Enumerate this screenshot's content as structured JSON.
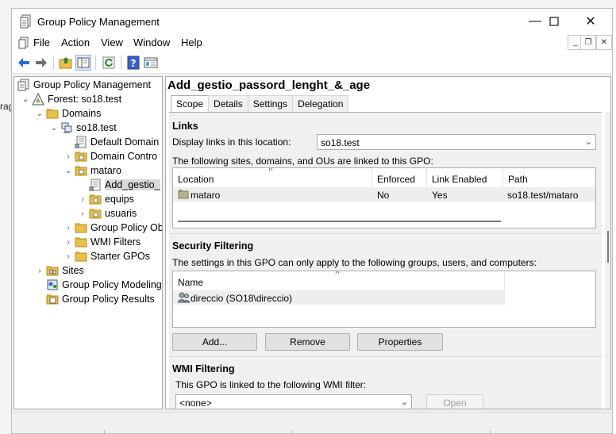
{
  "background": {
    "left_text": "rag"
  },
  "window": {
    "title": "Group Policy Management",
    "controls": {
      "minimize": "—",
      "maximize": "☐",
      "close": "✕"
    }
  },
  "menu": {
    "items": [
      "File",
      "Action",
      "View",
      "Window",
      "Help"
    ],
    "mdi": {
      "minimize": "_",
      "restore": "❐",
      "close": "✕"
    }
  },
  "toolbar": {
    "buttons": [
      "back-icon",
      "forward-icon",
      "up-folder-icon",
      "show-hide-tree-icon",
      "refresh-icon",
      "help-icon",
      "properties-icon"
    ]
  },
  "tree": {
    "items": [
      {
        "label": "Group Policy Management",
        "icon": "gpm-icon",
        "expander": ""
      },
      {
        "label": "Forest: so18.test",
        "icon": "forest-icon",
        "expander": "⌄"
      },
      {
        "label": "Domains",
        "icon": "folder-icon",
        "expander": "⌄"
      },
      {
        "label": "so18.test",
        "icon": "domain-icon",
        "expander": "⌄"
      },
      {
        "label": "Default Domain",
        "icon": "gpo-link-icon",
        "expander": ""
      },
      {
        "label": "Domain Contro",
        "icon": "ou-icon",
        "expander": "›"
      },
      {
        "label": "mataro",
        "icon": "ou-icon",
        "expander": "⌄"
      },
      {
        "label": "Add_gestio_",
        "icon": "gpo-link-icon",
        "expander": ""
      },
      {
        "label": "equips",
        "icon": "ou-icon",
        "expander": "›"
      },
      {
        "label": "usuaris",
        "icon": "ou-icon",
        "expander": "›"
      },
      {
        "label": "Group Policy Ob",
        "icon": "folder-icon",
        "expander": "›"
      },
      {
        "label": "WMI Filters",
        "icon": "folder-icon",
        "expander": "›"
      },
      {
        "label": "Starter GPOs",
        "icon": "folder-icon",
        "expander": "›"
      },
      {
        "label": "Sites",
        "icon": "sites-icon",
        "expander": "›"
      },
      {
        "label": "Group Policy Modeling",
        "icon": "modeling-icon",
        "expander": ""
      },
      {
        "label": "Group Policy Results",
        "icon": "results-icon",
        "expander": ""
      }
    ]
  },
  "details": {
    "gpo_name": "Add_gestio_passord_lenght_&_age",
    "tabs": [
      "Scope",
      "Details",
      "Settings",
      "Delegation"
    ],
    "links": {
      "title": "Links",
      "display_label": "Display links in this location:",
      "location_value": "so18.test",
      "description": "The following sites, domains, and OUs are linked to this GPO:",
      "columns": [
        "Location",
        "Enforced",
        "Link Enabled",
        "Path"
      ],
      "rows": [
        {
          "location": "mataro",
          "enforced": "No",
          "link_enabled": "Yes",
          "path": "so18.test/mataro"
        }
      ]
    },
    "security": {
      "title": "Security Filtering",
      "description": "The settings in this GPO can only apply to the following groups, users, and computers:",
      "columns": [
        "Name"
      ],
      "rows": [
        "direccio (SO18\\direccio)"
      ],
      "buttons": {
        "add": "Add...",
        "remove": "Remove",
        "properties": "Properties"
      }
    },
    "wmi": {
      "title": "WMI Filtering",
      "description": "This GPO is linked to the following WMI filter:",
      "filter_value": "<none>",
      "open_button": "Open"
    }
  }
}
